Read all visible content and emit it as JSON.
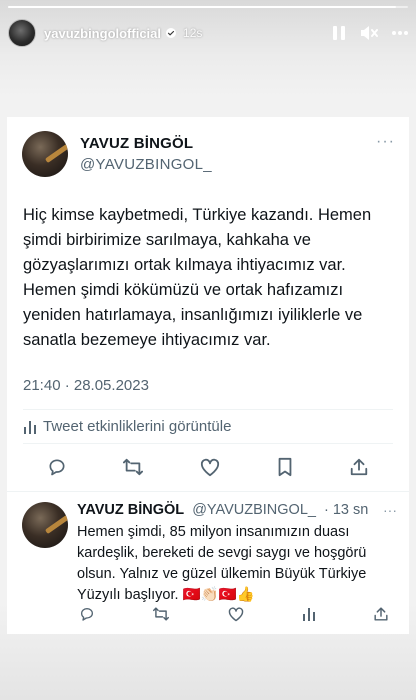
{
  "story": {
    "username": "yavuzbingolofficial",
    "time": "12s",
    "progress": 0.97
  },
  "tweet": {
    "name": "YAVUZ BİNGÖL",
    "handle": "@YAVUZBINGOL_",
    "text": "Hiç kimse kaybetmedi, Türkiye kazandı. Hemen şimdi birbirimize sarılmaya, kahkaha ve gözyaşlarımızı ortak kılmaya ihtiyacımız var. Hemen şimdi kökümüzü ve ortak hafızamızı yeniden hatırlamaya, insanlığımızı iyiliklerle ve sanatla bezemeye ihtiyacımız var.",
    "date": "21:40 · 28.05.2023",
    "activity_label": "Tweet etkinliklerini görüntüle"
  },
  "reply": {
    "name": "YAVUZ BİNGÖL",
    "handle": "@YAVUZBINGOL_",
    "time": "· 13 sn",
    "text": "Hemen şimdi, 85 milyon insanımızın duası kardeşlik, bereketi de sevgi saygı ve hoşgörü olsun. Yalnız ve güzel ülkemin Büyük Türkiye Yüzyılı başlıyor. 🇹🇷👏🏻🇹🇷👍"
  },
  "colors": {
    "text_primary": "#0f1419",
    "text_secondary": "#536471",
    "icon": "#536471"
  },
  "icons": [
    "pause-icon",
    "mute-icon",
    "more-icon",
    "verified-icon",
    "chart-icon",
    "reply-icon",
    "retweet-icon",
    "like-icon",
    "bookmark-icon",
    "share-icon"
  ]
}
